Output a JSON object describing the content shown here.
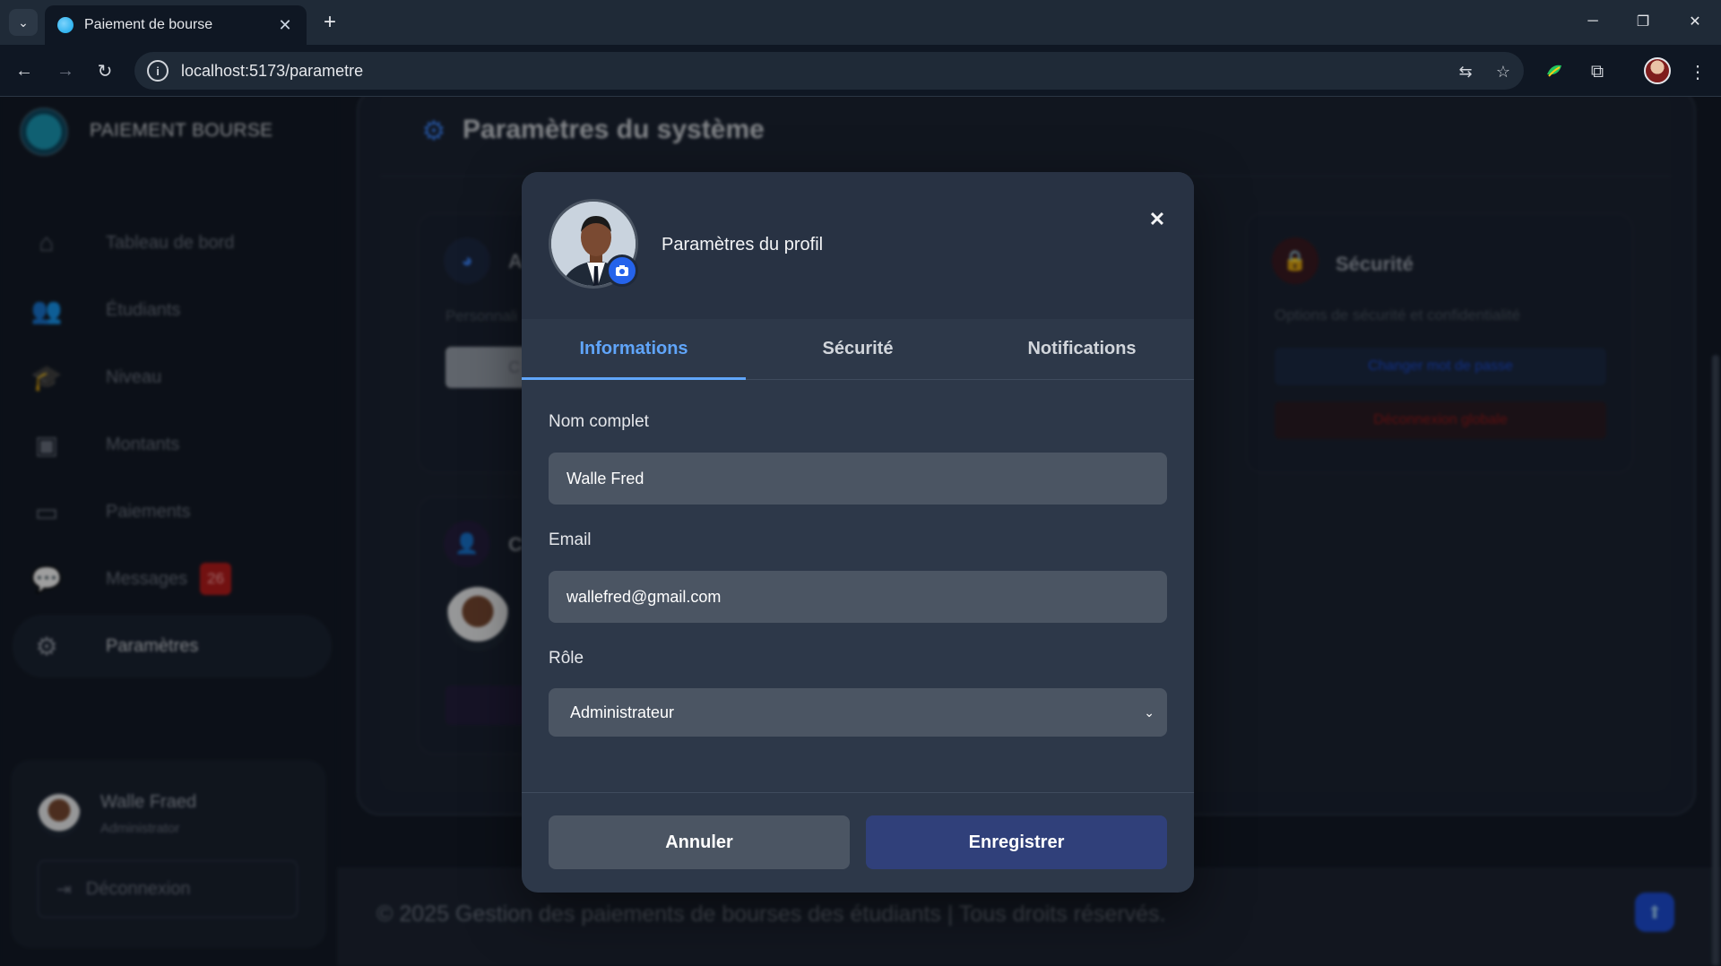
{
  "browser": {
    "tab_title": "Paiement de bourse",
    "new_tab": "+",
    "tab_close": "✕",
    "url": "localhost:5173/parametre",
    "minimize": "─",
    "restore": "❐",
    "close": "✕"
  },
  "sidebar": {
    "brand": "PAIEMENT BOURSE",
    "items": [
      {
        "label": "Tableau de bord",
        "icon": "home-icon"
      },
      {
        "label": "Étudiants",
        "icon": "users-icon"
      },
      {
        "label": "Niveau",
        "icon": "graduation-cap-icon"
      },
      {
        "label": "Montants",
        "icon": "money-icon"
      },
      {
        "label": "Paiements",
        "icon": "credit-card-icon"
      },
      {
        "label": "Messages",
        "icon": "chat-icon",
        "badge": "26"
      },
      {
        "label": "Paramètres",
        "icon": "gear-icon",
        "active": true
      }
    ],
    "user": {
      "name": "Walle Fraed",
      "role": "Administrator",
      "logout_label": "Déconnexion"
    }
  },
  "main": {
    "title": "Paramètres du système",
    "appearance_card": {
      "title_fragment": "A",
      "desc_fragment": "Personnali",
      "button_fragment": "C"
    },
    "account_card": {
      "title_fragment": "C"
    },
    "security_card": {
      "title": "Sécurité",
      "description": "Options de sécurité et confidentialité",
      "change_password": "Changer mot de passe",
      "global_logout": "Déconnexion globale"
    }
  },
  "footer": {
    "text": "© 2025 Gestion des paiements de bourses des étudiants | Tous droits réservés."
  },
  "modal": {
    "title": "Paramètres du profil",
    "close": "✕",
    "tabs": [
      {
        "label": "Informations",
        "active": true
      },
      {
        "label": "Sécurité"
      },
      {
        "label": "Notifications"
      }
    ],
    "fields": {
      "name_label": "Nom complet",
      "name_value": "Walle Fred",
      "email_label": "Email",
      "email_value": "wallefred@gmail.com",
      "role_label": "Rôle",
      "role_value": "Administrateur"
    },
    "cancel": "Annuler",
    "save": "Enregistrer"
  },
  "colors": {
    "accent": "#60a5fa",
    "save_button": "#30407a",
    "danger": "#b91c1c"
  }
}
